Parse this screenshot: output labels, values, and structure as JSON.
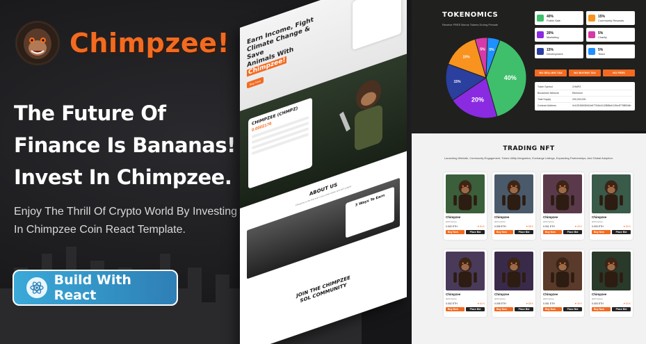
{
  "brand": {
    "name": "Chimpzee!",
    "logo_icon": "chimp-face-icon",
    "accent": "#f26b21"
  },
  "hero": {
    "headline": [
      "The Future Of",
      "Finance Is Bananas!",
      "Invest In Chimpzee."
    ],
    "subtext": [
      "Enjoy The Thrill Of Crypto World By Investing",
      "In Chimpzee Coin React Template."
    ],
    "cta_label": "Build With React",
    "cta_icon": "react-atom-icon"
  },
  "mock_page": {
    "hero_title": [
      "Earn Income, Fight",
      "Climate Change & Save",
      "Animals With",
      "Chimpzee!"
    ],
    "hero_button": "Buy Now",
    "presale_title": "CHIMPZEE (CHMPZ)",
    "presale_price": "0.0002178",
    "about_title": "ABOUT US",
    "about_text": "Chimpzee is the first ever cross-chain token and NFT project",
    "ways_title": "3 Ways To Earn",
    "community_title": [
      "JOIN THE CHIMPZEE",
      "SOL COMMUNITY"
    ]
  },
  "tokenomics": {
    "title": "TOKENOMICS",
    "subtitle": "Receive FREE Bonus Tokens During Presale",
    "slices": [
      {
        "pct": 40,
        "label": "40%",
        "name": "Public Sale",
        "color": "#3fbf6b"
      },
      {
        "pct": 20,
        "label": "20%",
        "name": "Marketing",
        "color": "#8a2be2"
      },
      {
        "pct": 15,
        "label": "15%",
        "name": "Development",
        "color": "#2a3f9e"
      },
      {
        "pct": 15,
        "label": "15%",
        "name": "Community Rewards",
        "color": "#f7931e"
      },
      {
        "pct": 5,
        "label": "5%",
        "name": "Charity",
        "color": "#d63aa8"
      },
      {
        "pct": 5,
        "label": "5%",
        "name": "Team",
        "color": "#1e90ff"
      }
    ],
    "legend": [
      {
        "pct": "40%",
        "name": "Public Sale",
        "color": "#3fbf6b"
      },
      {
        "pct": "15%",
        "name": "Community Rewards",
        "color": "#f7931e"
      },
      {
        "pct": "20%",
        "name": "Marketing",
        "color": "#8a2be2"
      },
      {
        "pct": "5%",
        "name": "Charity",
        "color": "#d63aa8"
      },
      {
        "pct": "15%",
        "name": "Development",
        "color": "#2a3f9e"
      },
      {
        "pct": "5%",
        "name": "Team",
        "color": "#1e90ff"
      }
    ],
    "tax_buttons": [
      "NO SELLING TAX",
      "NO BUYING TAX",
      "NO FEES"
    ],
    "info_rows": [
      {
        "k": "Token Symbol",
        "v": "CHMPZ"
      },
      {
        "k": "Blockchain Network",
        "v": "Ethereum"
      },
      {
        "k": "Total Supply",
        "v": "200,000,000"
      },
      {
        "k": "Contract Address",
        "v": "0x12E4560D0A0e6775Ab4112B88a0126e4F75BEb8b"
      }
    ]
  },
  "nft": {
    "title": "TRADING NFT",
    "subtitle": "Launching Website, Community Engagement, Token Utility Integration, Exchange Listings, Expanding Partnerships, And Global Adoption.",
    "cards": [
      {
        "name": "Chimpzee",
        "owner": "@chimpzee",
        "price": "0.002 ETH",
        "likes": "♥ 54 K",
        "buy": "Buy Now",
        "place": "Place Bid",
        "bg": "#3b5f3a"
      },
      {
        "name": "Chimpzee",
        "owner": "@chimpzee",
        "price": "0.005 ETH",
        "likes": "♥ 58 K",
        "buy": "Buy Now",
        "place": "Place Bid",
        "bg": "#4a5a6a"
      },
      {
        "name": "Chimpzee",
        "owner": "@chimpzee",
        "price": "0.001 ETH",
        "likes": "♥ 49 K",
        "buy": "Buy Now",
        "place": "Place Bid",
        "bg": "#5a3a4a"
      },
      {
        "name": "Chimpzee",
        "owner": "@chimpzee",
        "price": "0.003 ETH",
        "likes": "♥ 53 K",
        "buy": "Buy Now",
        "place": "Place Bid",
        "bg": "#3a5a4a"
      },
      {
        "name": "Chimpzee",
        "owner": "@chimpzee",
        "price": "0.002 ETH",
        "likes": "♥ 54 K",
        "buy": "Buy Now",
        "place": "Place Bid",
        "bg": "#4a3a5a"
      },
      {
        "name": "Chimpzee",
        "owner": "@chimpzee",
        "price": "0.005 ETH",
        "likes": "♥ 58 K",
        "buy": "Buy Now",
        "place": "Place Bid",
        "bg": "#3a2a4a"
      },
      {
        "name": "Chimpzee",
        "owner": "@chimpzee",
        "price": "0.001 ETH",
        "likes": "♥ 49 K",
        "buy": "Buy Now",
        "place": "Place Bid",
        "bg": "#5a3a2a"
      },
      {
        "name": "Chimpzee",
        "owner": "@chimpzee",
        "price": "0.003 ETH",
        "likes": "♥ 53 K",
        "buy": "Buy Now",
        "place": "Place Bid",
        "bg": "#2a3a2a"
      }
    ]
  }
}
